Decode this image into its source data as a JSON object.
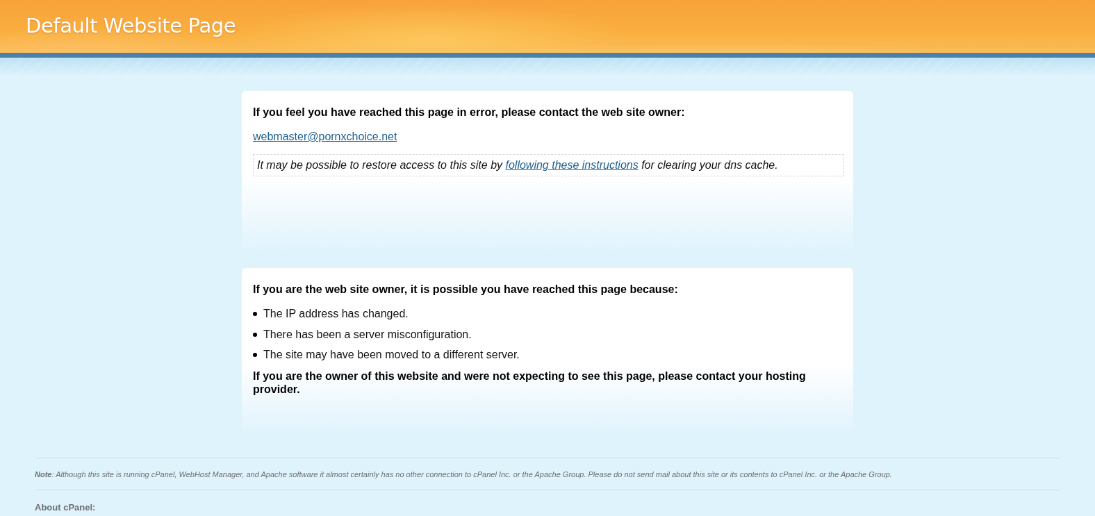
{
  "header": {
    "title": "Default Website Page"
  },
  "error_card": {
    "heading": "If you feel you have reached this page in error, please contact the web site owner:",
    "email": "webmaster@pornxchoice.net",
    "notice": {
      "before": "It may be possible to restore access to this site by",
      "link": "following these instructions",
      "after": "for clearing your dns cache."
    }
  },
  "owner_card": {
    "heading": "If you are the web site owner, it is possible you have reached this page because:",
    "reasons": [
      "The IP address has changed.",
      "There has been a server misconfiguration.",
      "The site may have been moved to a different server."
    ],
    "closing": "If you are the owner of this website and were not expecting to see this page, please contact your hosting provider."
  },
  "footer": {
    "note": "**Note**: Although this site is running cPanel, WebHost Manager, and Apache software it almost certainly has no other connection to cPanel Inc. or the Apache Group. Please do not send mail about this site or its contents to cPanel Inc. or the Apache Group.",
    "about_heading": "About cPanel:"
  }
}
